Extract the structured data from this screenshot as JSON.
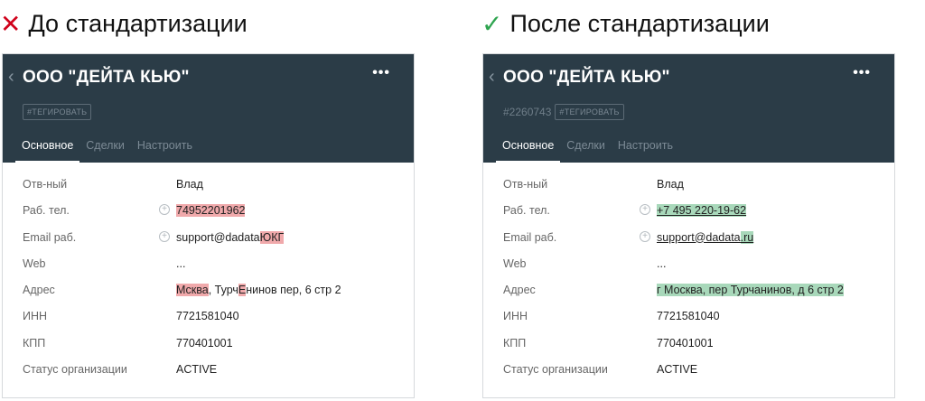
{
  "before": {
    "mark": "✕",
    "mark_color": "#d0021b",
    "title": "До стандартизации",
    "org_name": "ООО \"ДЕЙТА КЬЮ\"",
    "tag_button": "#ТЕГИРОВАТЬ",
    "tabs": [
      "Основное",
      "Сделки",
      "Настроить"
    ],
    "rows": {
      "owner": {
        "label": "Отв-ный",
        "value": "Влад"
      },
      "phone": {
        "label": "Раб. тел.",
        "value": "74952201962"
      },
      "email": {
        "label": "Email раб.",
        "value_a": "support@dadata",
        "value_b": "ЮКГ"
      },
      "web": {
        "label": "Web",
        "value": "..."
      },
      "address": {
        "label": "Адрес",
        "part1": "Мсква",
        "part2": ", Турч",
        "part3": "Е",
        "part4": "нинов пер,  6 стр 2"
      },
      "inn": {
        "label": "ИНН",
        "value": "7721581040"
      },
      "kpp": {
        "label": "КПП",
        "value": "770401001"
      },
      "status": {
        "label": "Статус организации",
        "value": "ACTIVE"
      }
    }
  },
  "after": {
    "mark": "✓",
    "mark_color": "#2ea44f",
    "title": "После стандартизации",
    "org_name": "ООО \"ДЕЙТА КЬЮ\"",
    "org_id": "#2260743",
    "tag_button": "#ТЕГИРОВАТЬ",
    "tabs": [
      "Основное",
      "Сделки",
      "Настроить"
    ],
    "rows": {
      "owner": {
        "label": "Отв-ный",
        "value": "Влад"
      },
      "phone": {
        "label": "Раб. тел.",
        "value": "+7 495 220-19-62"
      },
      "email": {
        "label": "Email раб.",
        "value_a": "support@dadata",
        "value_b": ".ru"
      },
      "web": {
        "label": "Web",
        "value": "..."
      },
      "address": {
        "label": "Адрес",
        "value": "г Москва, пер Турчанинов, д 6 стр 2"
      },
      "inn": {
        "label": "ИНН",
        "value": "7721581040"
      },
      "kpp": {
        "label": "КПП",
        "value": "770401001"
      },
      "status": {
        "label": "Статус организации",
        "value": "ACTIVE"
      }
    }
  },
  "colors": {
    "header_bg": "#2b3c47",
    "highlight_error": "#f0a9ab",
    "highlight_fixed": "#a8d8ba"
  },
  "icons": {
    "back": "chevron-left-icon",
    "more": "more-dots-icon",
    "add": "plus-circle-icon"
  }
}
